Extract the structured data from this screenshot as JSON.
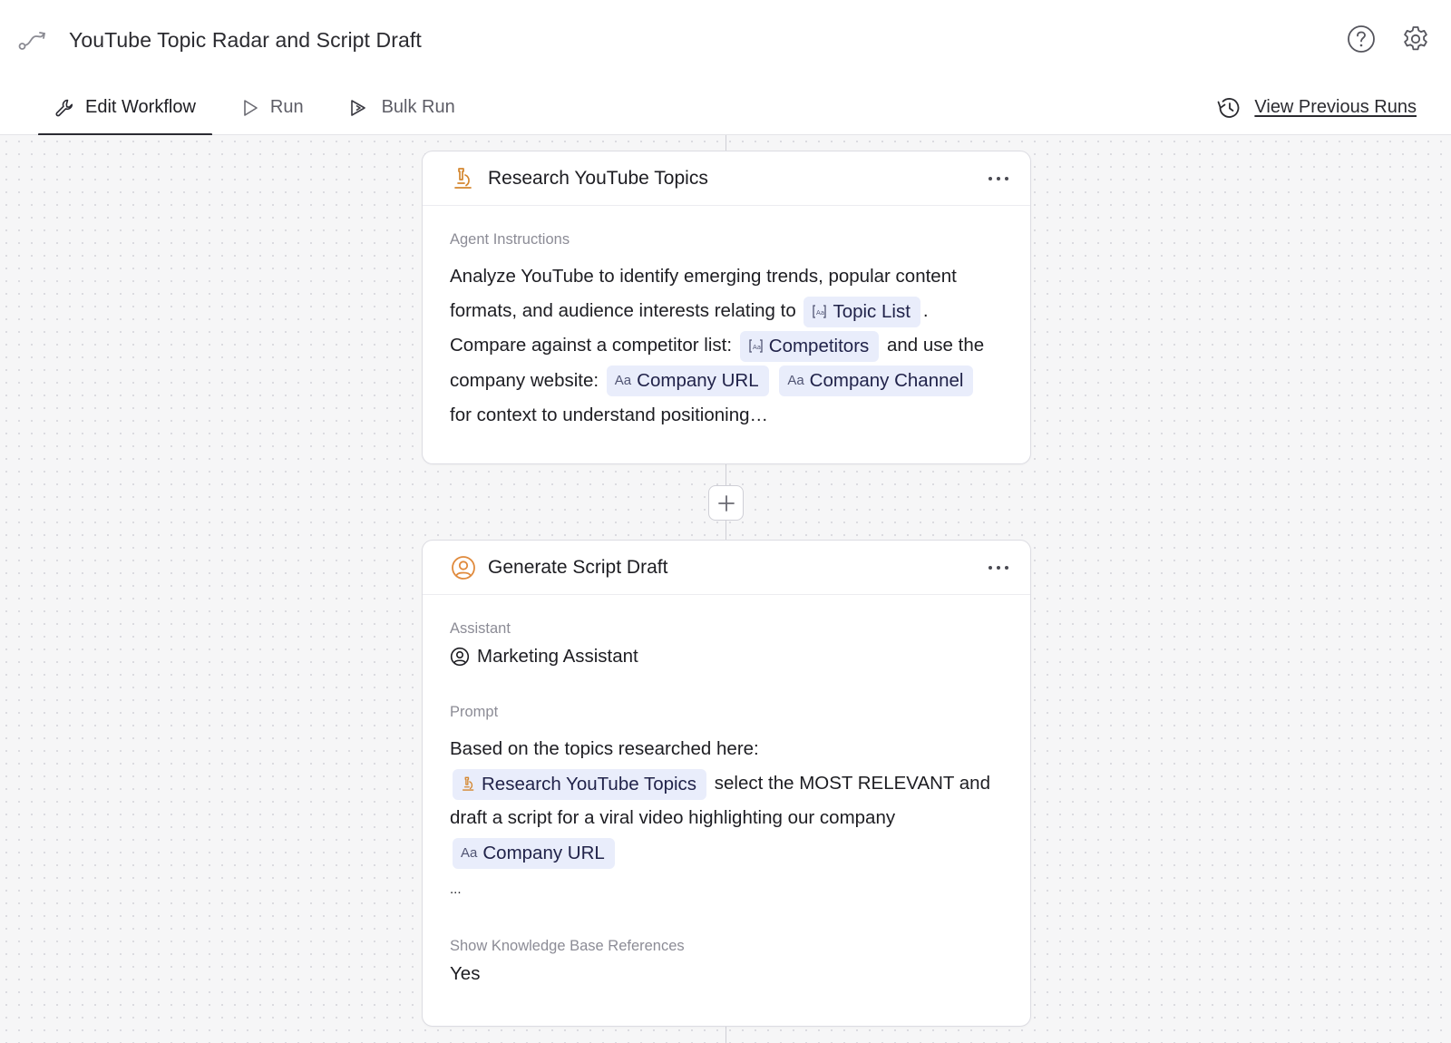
{
  "app": {
    "title": "YouTube Topic Radar and Script Draft"
  },
  "tabs": [
    {
      "label": "Edit Workflow",
      "icon": "wrench-icon",
      "active": true
    },
    {
      "label": "Run",
      "icon": "play-icon",
      "active": false
    },
    {
      "label": "Bulk Run",
      "icon": "bulk-play-icon",
      "active": false
    }
  ],
  "previous_runs": {
    "label": "View Previous Runs",
    "icon": "history-icon"
  },
  "steps": [
    {
      "title": "Research YouTube Topics",
      "icon": "microscope-icon",
      "field_label": "Agent Instructions",
      "instructions": {
        "t1": "Analyze YouTube to identify emerging trends, popular content formats, and audience interests relating to",
        "chip_topic_list": "Topic List",
        "t2": ".",
        "t3": "Compare against a competitor list:",
        "chip_competitors": "Competitors",
        "t4": "and use the company website:",
        "chip_company_url": "Company URL",
        "chip_company_channel": "Company Channel",
        "t5": "for context to understand positioning…"
      }
    },
    {
      "title": "Generate Script Draft",
      "icon": "user-circle-icon",
      "assistant_label": "Assistant",
      "assistant_value": "Marketing Assistant",
      "prompt_label": "Prompt",
      "prompt": {
        "t1": "Based on the topics researched here:",
        "chip_research": "Research YouTube Topics",
        "t2": "select the MOST RELEVANT and draft a script for a viral video highlighting our company",
        "chip_company_url": "Company URL",
        "ellipsis": "..."
      },
      "kb_label": "Show Knowledge Base References",
      "kb_value": "Yes"
    }
  ],
  "colors": {
    "accent_orange": "#e08a3c",
    "chip_bg": "#e9edfb",
    "tab_underline": "#2a2a32"
  }
}
